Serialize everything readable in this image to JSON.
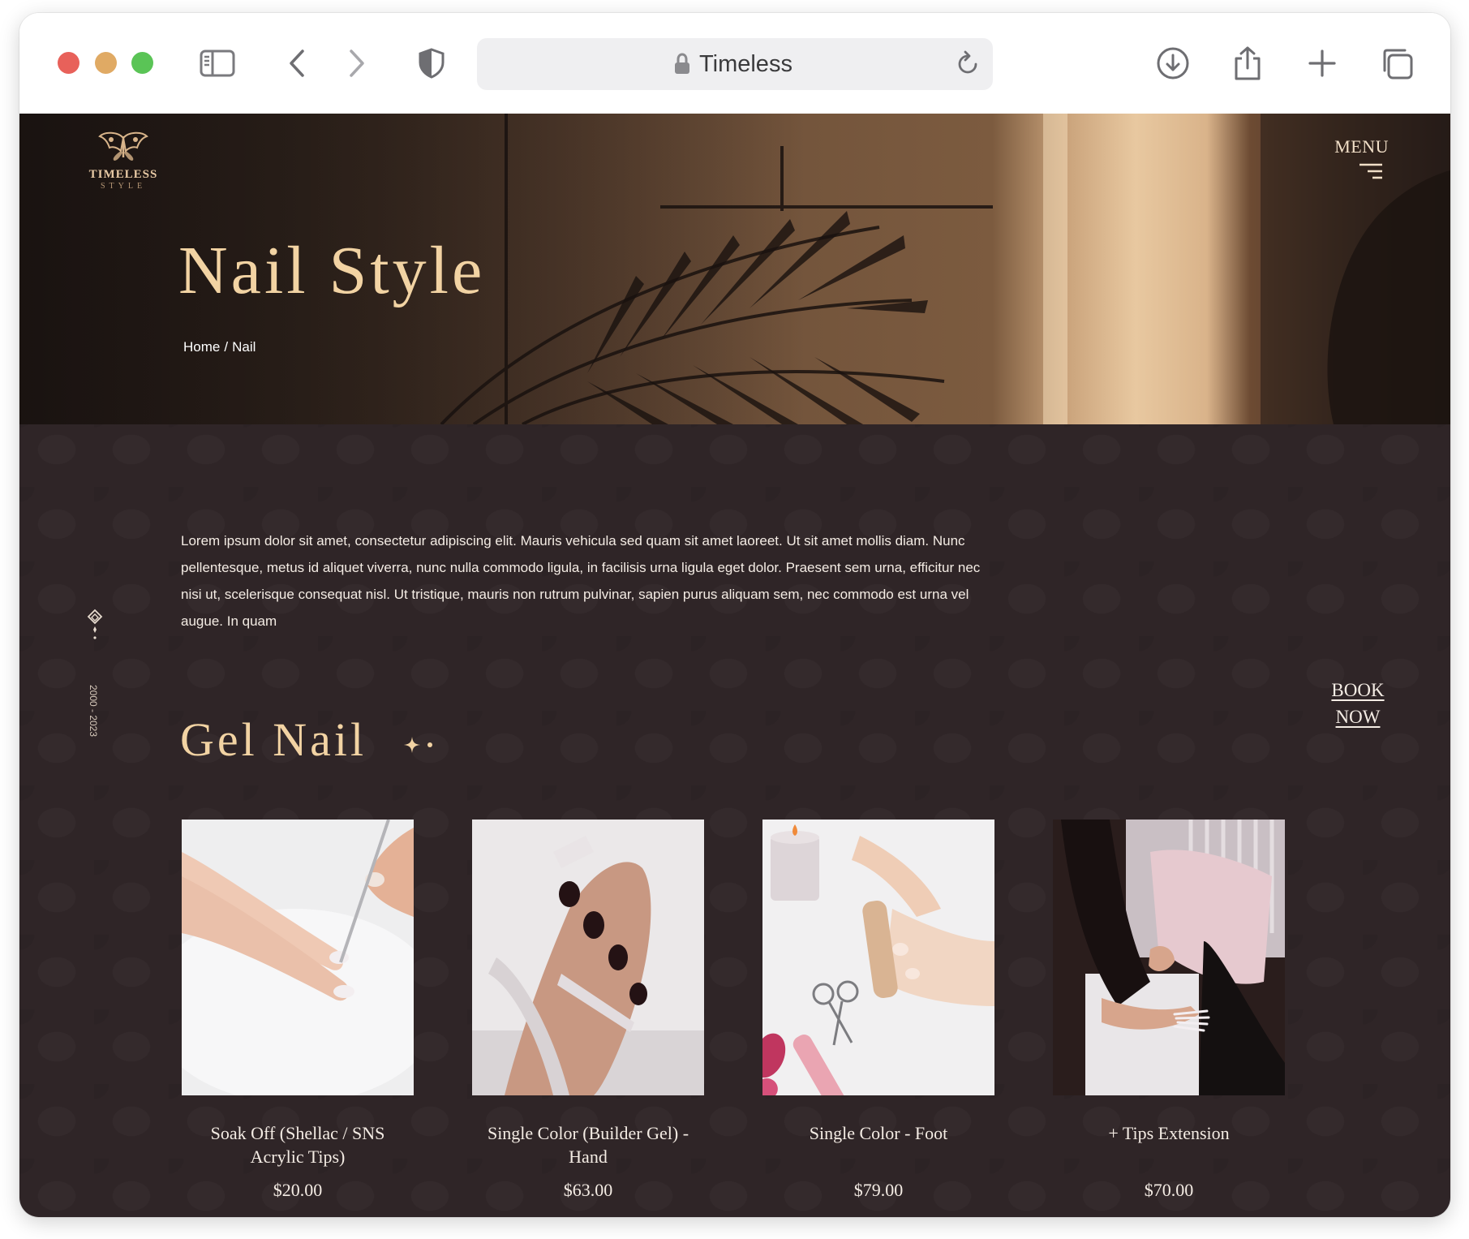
{
  "browser": {
    "tab_title": "Timeless",
    "colors": {
      "close": "#e8615a",
      "minimize": "#e0aa64",
      "maximize": "#5ac456"
    },
    "icons": [
      "sidebar-icon",
      "back-icon",
      "forward-icon",
      "shield-icon",
      "lock-icon",
      "reload-icon",
      "download-icon",
      "share-icon",
      "new-tab-icon",
      "tabs-overview-icon"
    ]
  },
  "site": {
    "logo": {
      "brand": "TIMELESS",
      "sub": "STYLE"
    },
    "menu_label": "MENU",
    "hero": {
      "title": "Nail Style",
      "breadcrumb": {
        "home": "Home",
        "separator": "/",
        "current": "Nail"
      }
    },
    "side_years": "2000 - 2023",
    "intro": "Lorem ipsum dolor sit amet, consectetur adipiscing elit. Mauris vehicula sed quam sit amet laoreet. Ut sit amet mollis diam. Nunc pellentesque, metus id aliquet viverra, nunc nulla commodo ligula, in facilisis urna ligula eget dolor. Praesent sem urna, efficitur nec nisi ut, scelerisque consequat nisl. Ut tristique, mauris non rutrum pulvinar, sapien purus aliquam sem, nec commodo est urna vel augue. In quam",
    "book_now": {
      "line1": "BOOK",
      "line2": "NOW"
    },
    "section_title": "Gel Nail",
    "services": [
      {
        "name": "Soak Off (Shellac / SNS Acrylic Tips)",
        "price": "$20.00"
      },
      {
        "name": "Single Color (Builder Gel) - Hand",
        "price": "$63.00"
      },
      {
        "name": "Single Color - Foot",
        "price": "$79.00"
      },
      {
        "name": "+ Tips Extension",
        "price": "$70.00"
      }
    ],
    "colors": {
      "background": "#2f2527",
      "accent_gold": "#f2d3a3",
      "text_light": "#f4ece4"
    }
  }
}
